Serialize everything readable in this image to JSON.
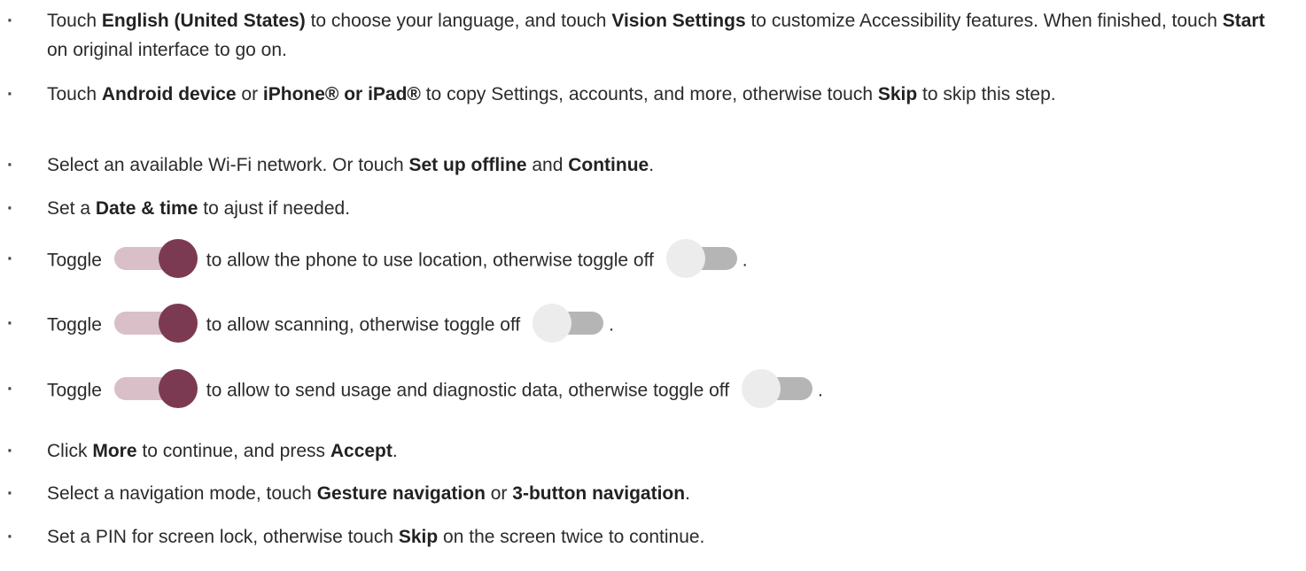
{
  "steps": [
    {
      "bullet": "·",
      "parts": [
        {
          "t": "Touch "
        },
        {
          "b": "English (United States)"
        },
        {
          "t": " to choose your language, and touch "
        },
        {
          "b": "Vision Settings"
        },
        {
          "t": " to customize Accessibility features. When finished, touch "
        },
        {
          "b": "Start"
        },
        {
          "t": " on original interface to go on."
        }
      ]
    },
    {
      "bullet": "·",
      "parts": [
        {
          "t": "Touch "
        },
        {
          "b": "Android device"
        },
        {
          "t": " or "
        },
        {
          "b": "iPhone® or iPad®"
        },
        {
          "t": " to copy Settings, accounts, and more, otherwise touch "
        },
        {
          "b": "Skip"
        },
        {
          "t": " to skip this step."
        }
      ]
    },
    {
      "bullet": "·",
      "parts": [
        {
          "t": "Select an available Wi-Fi network. Or touch "
        },
        {
          "b": "Set up offline"
        },
        {
          "t": " and "
        },
        {
          "b": "Continue"
        },
        {
          "t": "."
        }
      ]
    },
    {
      "bullet": "·",
      "parts": [
        {
          "t": "Set a "
        },
        {
          "b": "Date & time"
        },
        {
          "t": " to ajust if needed."
        }
      ]
    },
    {
      "bullet": "·",
      "parts": [
        {
          "t": "Toggle"
        },
        {
          "switch": "on"
        },
        {
          "t": "to allow the phone to use location, otherwise toggle off"
        },
        {
          "switch": "off"
        },
        {
          "t": "."
        }
      ]
    },
    {
      "bullet": "·",
      "parts": [
        {
          "t": "Toggle"
        },
        {
          "switch": "on"
        },
        {
          "t": "to allow scanning, otherwise toggle off"
        },
        {
          "switch": "off"
        },
        {
          "t": "."
        }
      ]
    },
    {
      "bullet": "·",
      "parts": [
        {
          "t": "Toggle"
        },
        {
          "switch": "on"
        },
        {
          "t": "to allow to send usage and diagnostic data, otherwise toggle off"
        },
        {
          "switch": "off"
        },
        {
          "t": "."
        }
      ]
    },
    {
      "bullet": "·",
      "parts": [
        {
          "t": "Click "
        },
        {
          "b": "More"
        },
        {
          "t": " to continue, and press "
        },
        {
          "b": "Accept"
        },
        {
          "t": "."
        }
      ]
    },
    {
      "bullet": "·",
      "parts": [
        {
          "t": "Select a navigation mode, touch "
        },
        {
          "b": "Gesture navigation"
        },
        {
          "t": " or "
        },
        {
          "b": "3-button navigation"
        },
        {
          "t": "."
        }
      ]
    },
    {
      "bullet": "·",
      "parts": [
        {
          "t": "Set a PIN for screen lock, otherwise touch "
        },
        {
          "b": "Skip"
        },
        {
          "t": " on the screen twice to continue."
        }
      ]
    }
  ],
  "colors": {
    "text": "#2b2b2b",
    "toggle_on_track": "#d9bfc8",
    "toggle_on_knob": "#7c3a52",
    "toggle_off_track": "#b5b5b5",
    "toggle_off_knob": "#ececec"
  }
}
